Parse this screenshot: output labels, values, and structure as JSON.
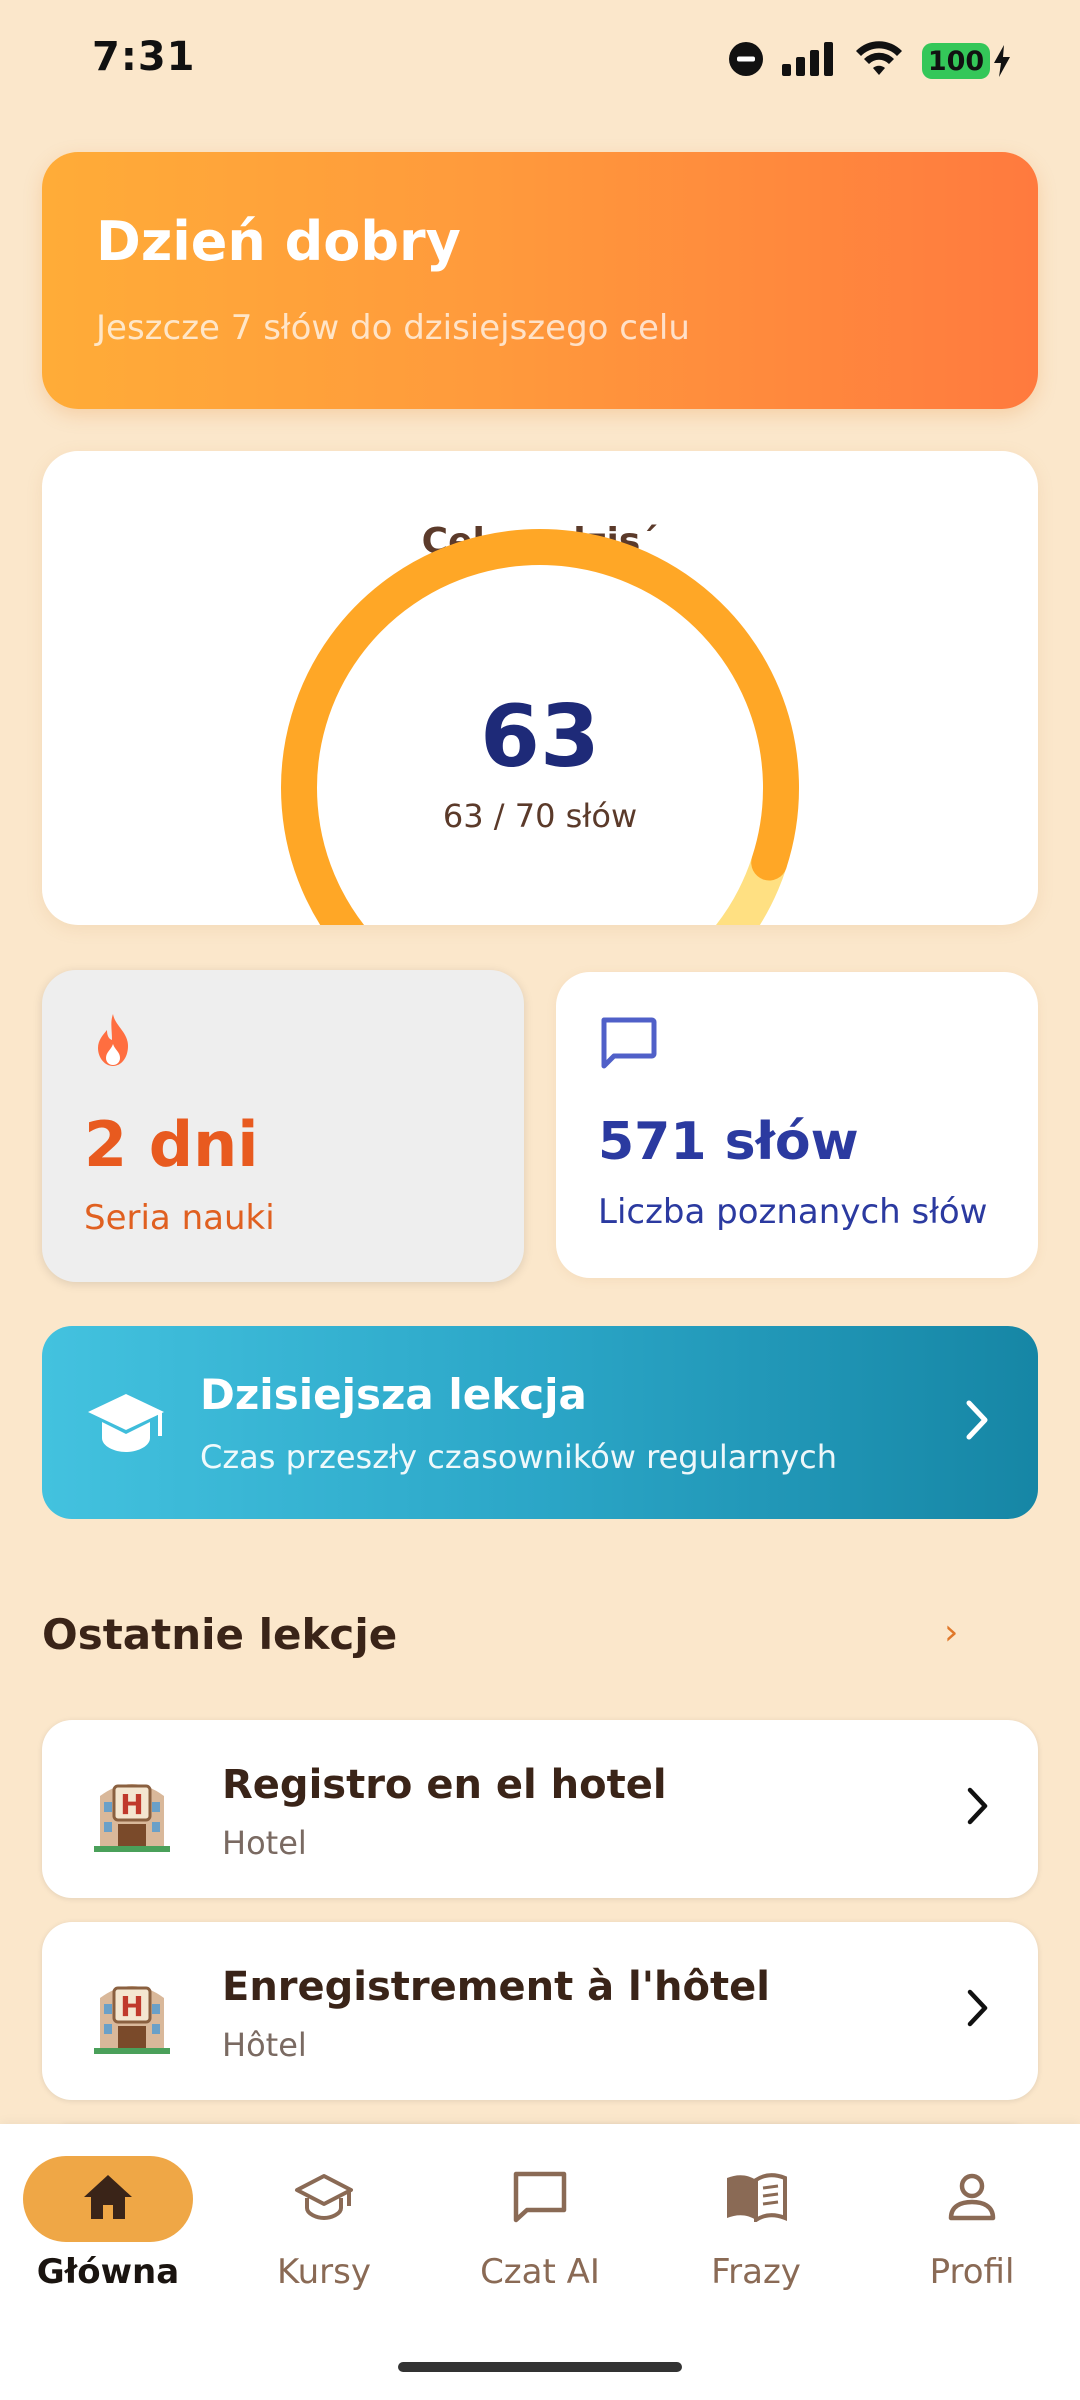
{
  "status_bar": {
    "time": "7:31",
    "battery": "100",
    "icons": [
      "dnd-icon",
      "signal-icon",
      "wifi-icon",
      "battery-icon",
      "charging-icon"
    ]
  },
  "greeting": {
    "title": "Dzień dobry",
    "subtitle": "Jeszcze 7 słów do dzisiejszego celu"
  },
  "goal": {
    "title": "Cel na dzis´",
    "value": "63",
    "progress_text": "63 / 70 słów",
    "current": 63,
    "target": 70,
    "colors": {
      "progress": "#ffa726",
      "remaining": "#ffe082"
    }
  },
  "stats": {
    "streak": {
      "icon": "flame-icon",
      "value": "2 dni",
      "label": "Seria nauki",
      "color": "#e85a1f"
    },
    "words": {
      "icon": "chat-bubble-icon",
      "value": "571 słów",
      "label": "Liczba poznanych słów",
      "color": "#2b3aa0"
    }
  },
  "today_lesson": {
    "icon": "graduation-cap-icon",
    "title": "Dzisiejsza lekcja",
    "subtitle": "Czas przeszły czasowników regularnych"
  },
  "recent": {
    "header": "Ostatnie lekcje",
    "more": "›",
    "items": [
      {
        "icon": "hotel-icon",
        "title": "Registro en el hotel",
        "subtitle": "Hotel"
      },
      {
        "icon": "hotel-icon",
        "title": "Enregistrement à l'hôtel",
        "subtitle": "Hôtel"
      }
    ]
  },
  "nav": {
    "items": [
      {
        "icon": "home-icon",
        "label": "Główna",
        "active": true
      },
      {
        "icon": "graduation-cap-icon",
        "label": "Kursy",
        "active": false
      },
      {
        "icon": "chat-icon",
        "label": "Czat AI",
        "active": false
      },
      {
        "icon": "book-icon",
        "label": "Frazy",
        "active": false
      },
      {
        "icon": "person-icon",
        "label": "Profil",
        "active": false
      }
    ]
  }
}
